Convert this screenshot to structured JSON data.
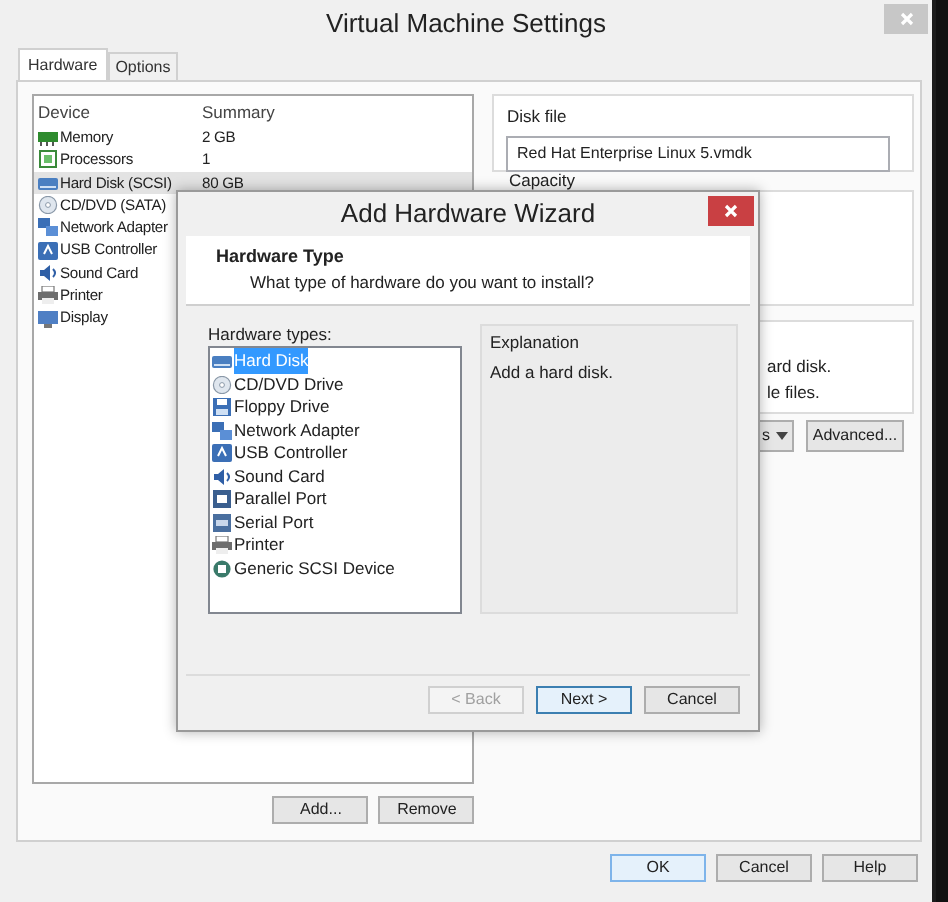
{
  "window": {
    "title": "Virtual Machine Settings"
  },
  "tabs": [
    {
      "label": "Hardware",
      "selected": true
    },
    {
      "label": "Options",
      "selected": false
    }
  ],
  "device_list": {
    "columns": [
      "Device",
      "Summary"
    ],
    "rows": [
      {
        "kind": "memory",
        "device": "Memory",
        "summary": "2 GB",
        "selected": false
      },
      {
        "kind": "processor",
        "device": "Processors",
        "summary": "1",
        "selected": false
      },
      {
        "kind": "disk",
        "device": "Hard Disk (SCSI)",
        "summary": "80 GB",
        "selected": true
      },
      {
        "kind": "disc",
        "device": "CD/DVD (SATA)",
        "selected": false
      },
      {
        "kind": "network",
        "device": "Network Adapter",
        "selected": false
      },
      {
        "kind": "usb",
        "device": "USB Controller",
        "selected": false
      },
      {
        "kind": "sound",
        "device": "Sound Card",
        "selected": false
      },
      {
        "kind": "printer",
        "device": "Printer",
        "selected": false
      },
      {
        "kind": "display",
        "device": "Display",
        "selected": false
      }
    ]
  },
  "device_buttons": [
    "Add...",
    "Remove"
  ],
  "disk_file": {
    "label": "Disk file",
    "value": "Red Hat Enterprise Linux 5.vmdk"
  },
  "capacity": {
    "label": "Capacity"
  },
  "disk_info_lines": [
    "ard disk.",
    "le files."
  ],
  "disk_buttons": [
    {
      "label": "s",
      "kind": "dropdown"
    },
    {
      "label": "Advanced...",
      "kind": "button"
    }
  ],
  "dialog_buttons": [
    "OK",
    "Cancel",
    "Help"
  ],
  "wizard": {
    "title": "Add Hardware Wizard",
    "heading": "Hardware Type",
    "subheading": "What type of hardware do you want to install?",
    "list_label": "Hardware types:",
    "hardware_types": [
      {
        "kind": "disk",
        "label": "Hard Disk",
        "selected": true
      },
      {
        "kind": "disc",
        "label": "CD/DVD Drive",
        "selected": false
      },
      {
        "kind": "floppy",
        "label": "Floppy Drive",
        "selected": false
      },
      {
        "kind": "network",
        "label": "Network Adapter",
        "selected": false
      },
      {
        "kind": "usb",
        "label": "USB Controller",
        "selected": false
      },
      {
        "kind": "sound",
        "label": "Sound Card",
        "selected": false
      },
      {
        "kind": "parallel",
        "label": "Parallel Port",
        "selected": false
      },
      {
        "kind": "serial",
        "label": "Serial Port",
        "selected": false
      },
      {
        "kind": "printer",
        "label": "Printer",
        "selected": false
      },
      {
        "kind": "scsi",
        "label": "Generic SCSI Device",
        "selected": false
      }
    ],
    "explanation": {
      "label": "Explanation",
      "text": "Add a hard disk."
    },
    "buttons": [
      {
        "label": "< Back",
        "disabled": true,
        "default": false
      },
      {
        "label": "Next >",
        "disabled": false,
        "default": true
      },
      {
        "label": "Cancel",
        "disabled": false,
        "default": false
      }
    ]
  }
}
